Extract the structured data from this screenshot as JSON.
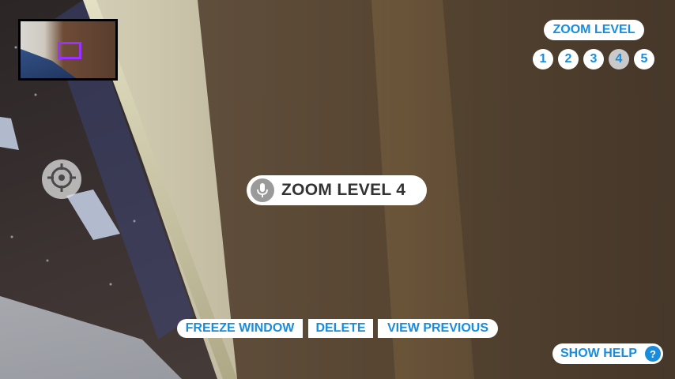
{
  "zoom": {
    "header_label": "ZOOM LEVEL",
    "levels": [
      "1",
      "2",
      "3",
      "4",
      "5"
    ],
    "active_level": "4"
  },
  "status": {
    "message": "ZOOM LEVEL 4",
    "icon": "microphone-icon"
  },
  "actions": {
    "freeze_label": "FREEZE WINDOW",
    "delete_label": "DELETE",
    "view_previous_label": "VIEW PREVIOUS"
  },
  "help": {
    "label": "SHOW HELP",
    "icon_glyph": "?"
  },
  "icons": {
    "crosshair": "crosshair-icon",
    "microphone": "microphone-icon",
    "help": "help-icon"
  },
  "colors": {
    "accent": "#1a8cdb",
    "minimap_frame": "#9b30ff",
    "active_zoom_bg": "#c9c9c9"
  }
}
